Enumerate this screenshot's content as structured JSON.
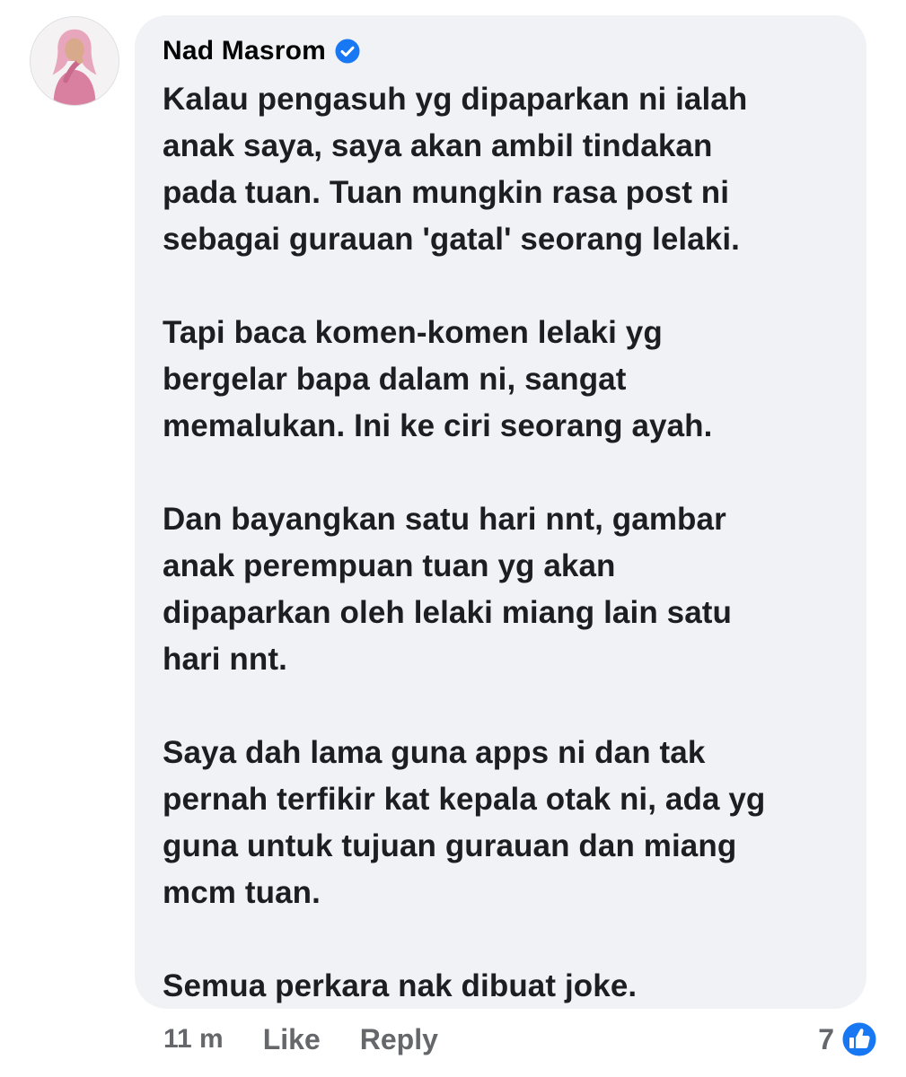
{
  "comment": {
    "author": "Nad Masrom",
    "verified_icon": "verified-badge-icon",
    "paragraphs": [
      "Kalau pengasuh yg dipaparkan ni ialah\nanak saya, saya akan ambil tindakan\npada tuan. Tuan mungkin rasa post ni\nsebagai gurauan 'gatal' seorang lelaki.",
      "Tapi baca komen-komen lelaki yg\nbergelar bapa dalam ni, sangat\nmemalukan. Ini ke ciri seorang ayah.",
      "Dan bayangkan satu hari nnt, gambar\nanak perempuan tuan yg akan\ndipaparkan oleh lelaki miang lain satu\nhari nnt.",
      "Saya dah lama guna apps ni dan tak\npernah terfikir kat kepala otak ni, ada yg\nguna untuk tujuan gurauan dan miang\nmcm tuan.",
      "Semua perkara nak dibuat joke."
    ]
  },
  "actions": {
    "timestamp": "11 m",
    "like_label": "Like",
    "reply_label": "Reply"
  },
  "reactions": {
    "count": "7",
    "icon": "like-reaction-icon"
  },
  "colors": {
    "bubble_bg": "#f0f2f5",
    "text": "#1c1e21",
    "meta": "#65676b",
    "accent": "#1877f2"
  }
}
